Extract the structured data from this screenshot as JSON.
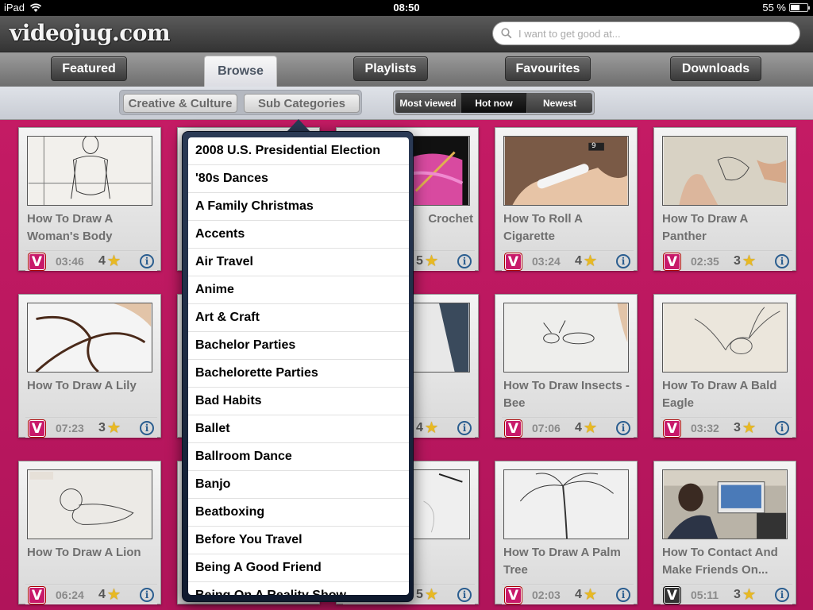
{
  "status_bar": {
    "device": "iPad",
    "time": "08:50",
    "battery": "55 %",
    "battery_level": 0.55
  },
  "header": {
    "logo": "videojug.com",
    "search_placeholder": "I want to get good at..."
  },
  "tabs": [
    {
      "label": "Featured",
      "active": false
    },
    {
      "label": "Browse",
      "active": true
    },
    {
      "label": "Playlists",
      "active": false
    },
    {
      "label": "Favourites",
      "active": false
    },
    {
      "label": "Downloads",
      "active": false
    }
  ],
  "subbar": {
    "category_button": "Creative & Culture",
    "subcategories_button": "Sub Categories",
    "sort_options": [
      "Most viewed",
      "Hot now",
      "Newest"
    ],
    "sort_selected": "Hot now"
  },
  "videos": [
    {
      "title": "How To Draw A Woman's Body",
      "duration": "03:46",
      "rating": "4"
    },
    {
      "title": "",
      "duration": "",
      "rating": ""
    },
    {
      "title": "Crochet",
      "duration": "",
      "rating": "5"
    },
    {
      "title": "How To Roll A Cigarette",
      "duration": "03:24",
      "rating": "4"
    },
    {
      "title": "How To Draw A Panther",
      "duration": "02:35",
      "rating": "3"
    },
    {
      "title": "How To Draw A Lily",
      "duration": "07:23",
      "rating": "3"
    },
    {
      "title": "",
      "duration": "",
      "rating": ""
    },
    {
      "title": "w A",
      "duration": "",
      "rating": "4"
    },
    {
      "title": "How To Draw Insects - Bee",
      "duration": "07:06",
      "rating": "4"
    },
    {
      "title": "How To Draw A Bald Eagle",
      "duration": "03:32",
      "rating": "3"
    },
    {
      "title": "How To Draw A Lion",
      "duration": "06:24",
      "rating": "4"
    },
    {
      "title": "",
      "duration": "",
      "rating": ""
    },
    {
      "title": "w A",
      "duration": "",
      "rating": "5"
    },
    {
      "title": "How To Draw A Palm Tree",
      "duration": "02:03",
      "rating": "4"
    },
    {
      "title": "How To Contact And Make Friends On...",
      "duration": "05:11",
      "rating": "3"
    }
  ],
  "thumb_badge": "9",
  "subcategories": [
    "2008 U.S. Presidential Election",
    "'80s Dances",
    "A Family Christmas",
    "Accents",
    "Air Travel",
    "Anime",
    "Art & Craft",
    "Bachelor Parties",
    "Bachelorette Parties",
    "Bad Habits",
    "Ballet",
    "Ballroom Dance",
    "Banjo",
    "Beatboxing",
    "Before You Travel",
    "Being A Good Friend",
    "Being On A Reality Show"
  ],
  "colors": {
    "background": "#c41b64",
    "badge": "#c8196a",
    "info": "#2a5d8f",
    "star": "#e8b923"
  },
  "icons": {
    "badge_letter": "V",
    "star": "★",
    "info": "i",
    "search": "search-icon",
    "wifi": "wifi-icon"
  }
}
